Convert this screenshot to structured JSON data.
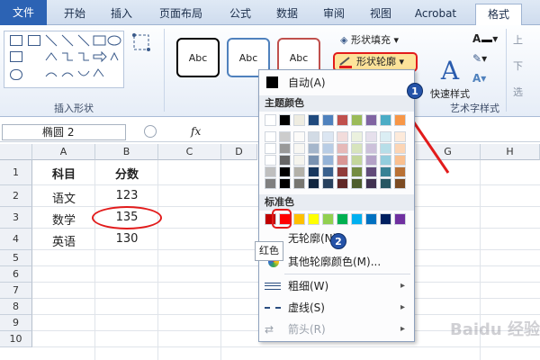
{
  "tabs": [
    "文件",
    "开始",
    "插入",
    "页面布局",
    "公式",
    "数据",
    "审阅",
    "视图",
    "Acrobat",
    "格式"
  ],
  "ribbon": {
    "insert_shapes_label": "插入形状",
    "style_label": "Abc",
    "shape_fill": "形状填充",
    "shape_outline": "形状轮廓",
    "quick_styles": "快速样式",
    "art_text_label": "艺术字样式"
  },
  "formula_bar": {
    "name_box": "椭圆 2",
    "fx": "fx"
  },
  "columns": [
    "A",
    "B",
    "C",
    "D",
    "G",
    "H"
  ],
  "rows": [
    "1",
    "2",
    "3",
    "4",
    "5",
    "6",
    "7",
    "8",
    "9",
    "10"
  ],
  "cells": {
    "a1": "科目",
    "b1": "分数",
    "a2": "语文",
    "b2": "123",
    "a3": "数学",
    "b3": "135",
    "a4": "英语",
    "b4": "130"
  },
  "menu": {
    "auto": "自动(A)",
    "theme_colors": "主题颜色",
    "standard_colors": "标准色",
    "no_outline": "无轮廓(N)",
    "more_colors": "其他轮廓颜色(M)...",
    "weight": "粗细(W)",
    "dashes": "虚线(S)",
    "arrows": "箭头(R)"
  },
  "tooltip": "红色",
  "badges": [
    "1",
    "2"
  ],
  "theme_top": [
    "#ffffff",
    "#000000",
    "#eeece1",
    "#1f497d",
    "#4f81bd",
    "#c0504d",
    "#9bbb59",
    "#8064a2",
    "#4bacc6",
    "#f79646"
  ],
  "standard": [
    "#c00000",
    "#ff0000",
    "#ffc000",
    "#ffff00",
    "#92d050",
    "#00b050",
    "#00b0f0",
    "#0070c0",
    "#002060",
    "#7030a0"
  ],
  "watermark": "Baidu 经验"
}
